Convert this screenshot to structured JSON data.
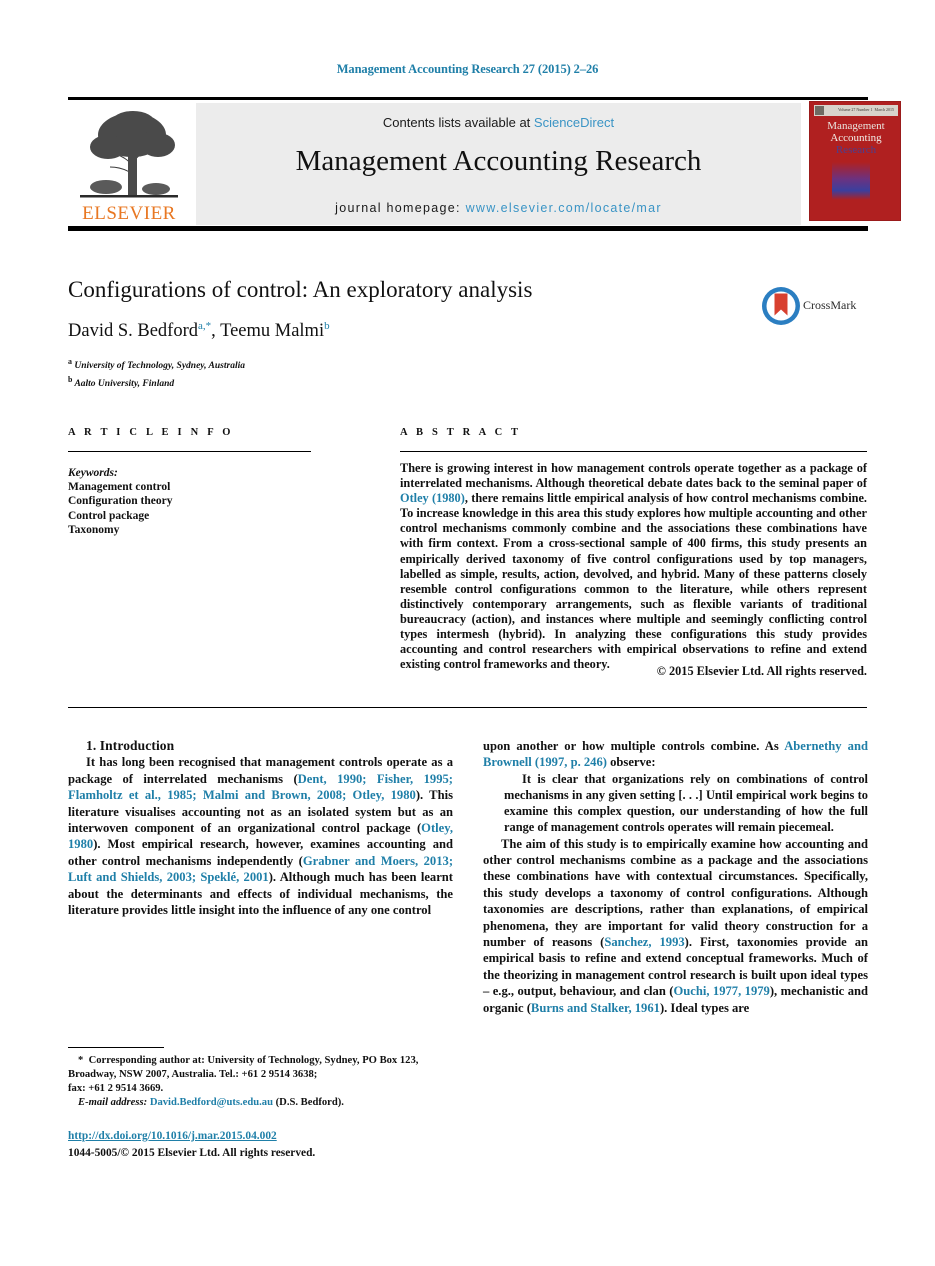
{
  "running_head": "Management Accounting Research 27 (2015) 2–26",
  "masthead": {
    "contents_prefix": "Contents lists available at ",
    "sciencedirect": "ScienceDirect",
    "journal_name": "Management Accounting Research",
    "homepage_prefix": "journal homepage: ",
    "homepage_url": "www.elsevier.com/locate/mar",
    "publisher_logo_text": "ELSEVIER",
    "publisher_logo_icon": "elsevier-tree-icon",
    "cover": {
      "line1": "Management",
      "line2": "Accounting",
      "line3": "Research",
      "strip_left": "Volume 27 Number 1",
      "strip_right": "March 2015",
      "background_color": "#b02020"
    }
  },
  "article": {
    "title": "Configurations of control: An exploratory analysis",
    "authors_html": "David S. Bedford",
    "author1": "David S. Bedford",
    "author1_marks": "a,*",
    "author2": "Teemu Malmi",
    "author2_marks": "b",
    "affiliations": [
      {
        "mark": "a",
        "text": "University of Technology, Sydney, Australia"
      },
      {
        "mark": "b",
        "text": "Aalto University, Finland"
      }
    ],
    "crossmark_label": "CrossMark"
  },
  "sections": {
    "article_info_heading": "A R T I C L E   I N F O",
    "abstract_heading": "A B S T R A C T"
  },
  "keywords": {
    "label": "Keywords:",
    "items": [
      "Management control",
      "Configuration theory",
      "Control package",
      "Taxonomy"
    ]
  },
  "abstract": {
    "part1": "There is growing interest in how management controls operate together as a package of interrelated mechanisms. Although theoretical debate dates back to the seminal paper of ",
    "ref1": "Otley (1980)",
    "part2": ", there remains little empirical analysis of how control mechanisms combine. To increase knowledge in this area this study explores how multiple accounting and other control mechanisms commonly combine and the associations these combinations have with firm context. From a cross-sectional sample of 400 firms, this study presents an empirically derived taxonomy of five control configurations used by top managers, labelled as simple, results, action, devolved, and hybrid. Many of these patterns closely resemble control configurations common to the literature, while others represent distinctively contemporary arrangements, such as flexible variants of traditional bureaucracy (action), and instances where multiple and seemingly conflicting control types intermesh (hybrid). In analyzing these configurations this study provides accounting and control researchers with empirical observations to refine and extend existing control frameworks and theory.",
    "copyright": "© 2015 Elsevier Ltd. All rights reserved."
  },
  "body": {
    "intro_heading": "1. Introduction",
    "left_p1_a": "It has long been recognised that management controls operate as a package of interrelated mechanisms (",
    "left_p1_ref1": "Dent, 1990; Fisher, 1995; Flamholtz et al., 1985; Malmi and Brown, 2008; Otley, 1980",
    "left_p1_b": "). This literature visualises accounting not as an isolated system but as an interwoven component of an organizational control package (",
    "left_p1_ref2": "Otley, 1980",
    "left_p1_c": "). Most empirical research, however, examines accounting and other control mechanisms independently (",
    "left_p1_ref3": "Grabner and Moers, 2013; Luft and Shields, 2003; Speklé, 2001",
    "left_p1_d": "). Although much has been learnt about the determinants and effects of individual mechanisms, the literature provides little insight into the influence of any one control",
    "right_p1_a": "upon another or how multiple controls combine. As ",
    "right_p1_ref": "Abernethy and Brownell (1997, p. 246)",
    "right_p1_b": " observe:",
    "right_quote": "It is clear that organizations rely on combinations of control mechanisms in any given setting [. . .] Until empirical work begins to examine this complex question, our understanding of how the full range of management controls operates will remain piecemeal.",
    "right_p2_a": "The aim of this study is to empirically examine how accounting and other control mechanisms combine as a package and the associations these combinations have with contextual circumstances. Specifically, this study develops a taxonomy of control configurations. Although taxonomies are descriptions, rather than explanations, of empirical phenomena, they are important for valid theory construction for a number of reasons (",
    "right_p2_ref1": "Sanchez, 1993",
    "right_p2_b": "). First, taxonomies provide an empirical basis to refine and extend conceptual frameworks. Much of the theorizing in management control research is built upon ideal types – e.g., output, behaviour, and clan (",
    "right_p2_ref2": "Ouchi, 1977, 1979",
    "right_p2_c": "), mechanistic and organic (",
    "right_p2_ref3": "Burns and Stalker, 1961",
    "right_p2_d": "). Ideal types are"
  },
  "footnotes": {
    "corresponding_mark": "*",
    "corresponding": "Corresponding author at: University of Technology, Sydney, PO Box 123, Broadway, NSW 2007, Australia. Tel.: +61 2 9514 3638;",
    "fax": "fax: +61 2 9514 3669.",
    "email_label": "E-mail address:",
    "email": "David.Bedford@uts.edu.au",
    "email_suffix": "(D.S. Bedford).",
    "doi": "http://dx.doi.org/10.1016/j.mar.2015.04.002",
    "issn_line": "1044-5005/© 2015 Elsevier Ltd. All rights reserved."
  },
  "colors": {
    "link": "#1f7fa8",
    "sciencedirect": "#3a94c5",
    "elsevier_orange": "#e87722",
    "cover_red": "#b02020",
    "band_gray": "#ececec"
  }
}
